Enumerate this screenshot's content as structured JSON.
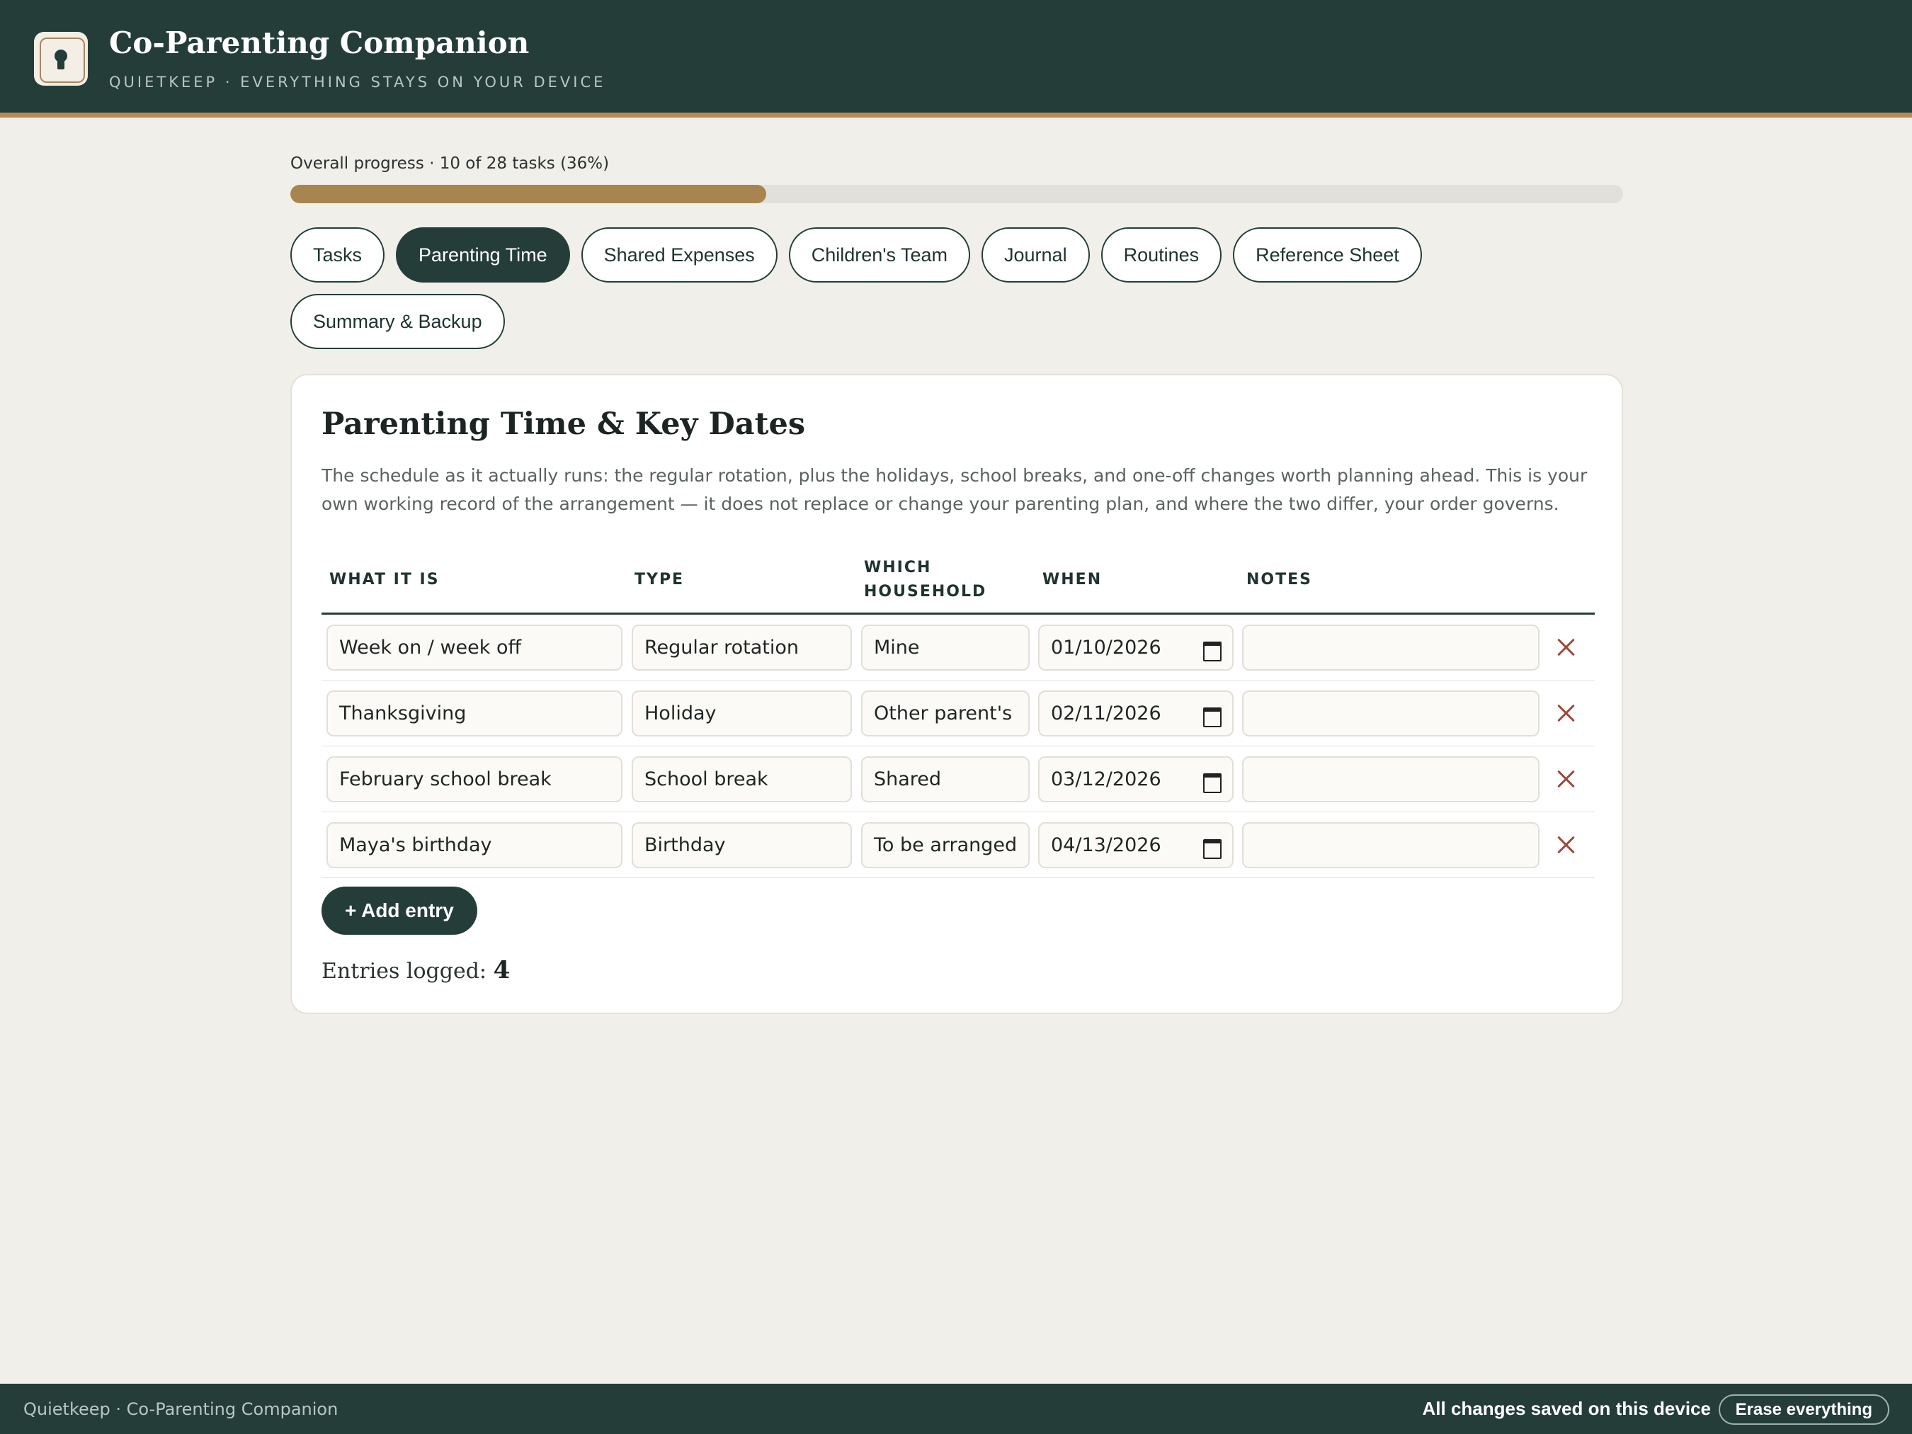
{
  "header": {
    "title": "Co-Parenting Companion",
    "subtitle": "QUIETKEEP · EVERYTHING STAYS ON YOUR DEVICE",
    "logo_icon": "keyhole-icon"
  },
  "progress": {
    "label": "Overall progress · 10 of 28 tasks (36%)",
    "done": 10,
    "total": 28,
    "percent": 36
  },
  "tabs": [
    {
      "label": "Tasks",
      "active": false
    },
    {
      "label": "Parenting Time",
      "active": true
    },
    {
      "label": "Shared Expenses",
      "active": false
    },
    {
      "label": "Children's Team",
      "active": false
    },
    {
      "label": "Journal",
      "active": false
    },
    {
      "label": "Routines",
      "active": false
    },
    {
      "label": "Reference Sheet",
      "active": false
    },
    {
      "label": "Summary & Backup",
      "active": false
    }
  ],
  "section": {
    "title": "Parenting Time & Key Dates",
    "description": "The schedule as it actually runs: the regular rotation, plus the holidays, school breaks, and one-off changes worth planning ahead. This is your own working record of the arrangement — it does not replace or change your parenting plan, and where the two differ, your order governs."
  },
  "table": {
    "columns": [
      "WHAT IT IS",
      "TYPE",
      "WHICH HOUSEHOLD",
      "WHEN",
      "NOTES"
    ],
    "rows": [
      {
        "what": "Week on / week off",
        "type": "Regular rotation",
        "household": "Mine",
        "when": "01/10/2026",
        "notes": ""
      },
      {
        "what": "Thanksgiving",
        "type": "Holiday",
        "household": "Other parent's",
        "when": "02/11/2026",
        "notes": ""
      },
      {
        "what": "February school break",
        "type": "School break",
        "household": "Shared",
        "when": "03/12/2026",
        "notes": ""
      },
      {
        "what": "Maya's birthday",
        "type": "Birthday",
        "household": "To be arranged",
        "when": "04/13/2026",
        "notes": ""
      }
    ]
  },
  "add_button_label": "+ Add entry",
  "entries": {
    "label": "Entries logged:",
    "count": "4"
  },
  "footer": {
    "left_text": "Quietkeep · Co-Parenting Companion",
    "status": "All changes saved on this device",
    "erase_label": "Erase everything"
  },
  "colors": {
    "primary": "#243d38",
    "accent": "#b48a57",
    "progress_fill": "#a8854e",
    "background": "#f1efea",
    "delete": "#9a4a3c"
  }
}
